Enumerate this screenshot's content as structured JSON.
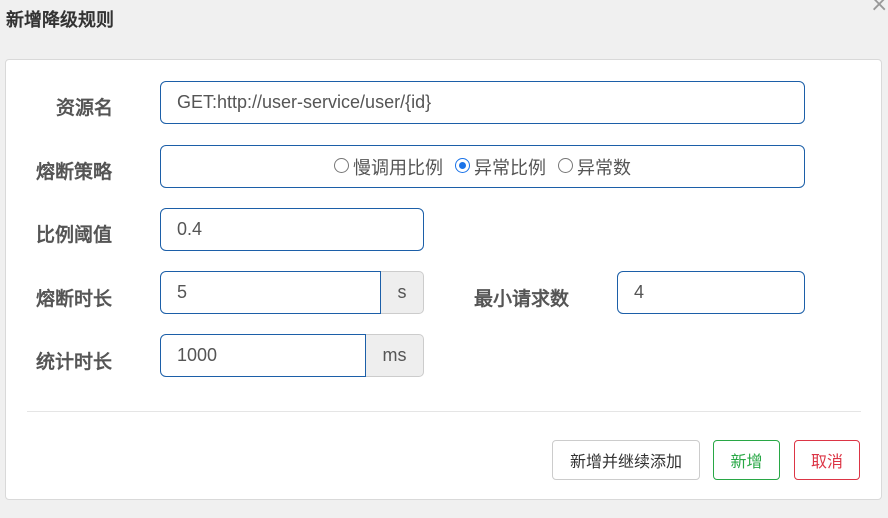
{
  "dialog": {
    "title": "新增降级规则",
    "close_icon": "close-icon"
  },
  "form": {
    "resource": {
      "label": "资源名",
      "value": "GET:http://user-service/user/{id}"
    },
    "strategy": {
      "label": "熔断策略",
      "options": [
        "慢调用比例",
        "异常比例",
        "异常数"
      ],
      "selected": "异常比例"
    },
    "ratio_threshold": {
      "label": "比例阈值",
      "value": "0.4"
    },
    "break_duration": {
      "label": "熔断时长",
      "value": "5",
      "unit": "s"
    },
    "min_requests": {
      "label": "最小请求数",
      "value": "4"
    },
    "stat_duration": {
      "label": "统计时长",
      "value": "1000",
      "unit": "ms"
    }
  },
  "actions": {
    "add_continue": "新增并继续添加",
    "add": "新增",
    "cancel": "取消"
  },
  "colors": {
    "input_border": "#1c5fa8",
    "radio_checked": "#1a73e8",
    "add_button": "#28a745",
    "cancel_button": "#dc3545"
  }
}
